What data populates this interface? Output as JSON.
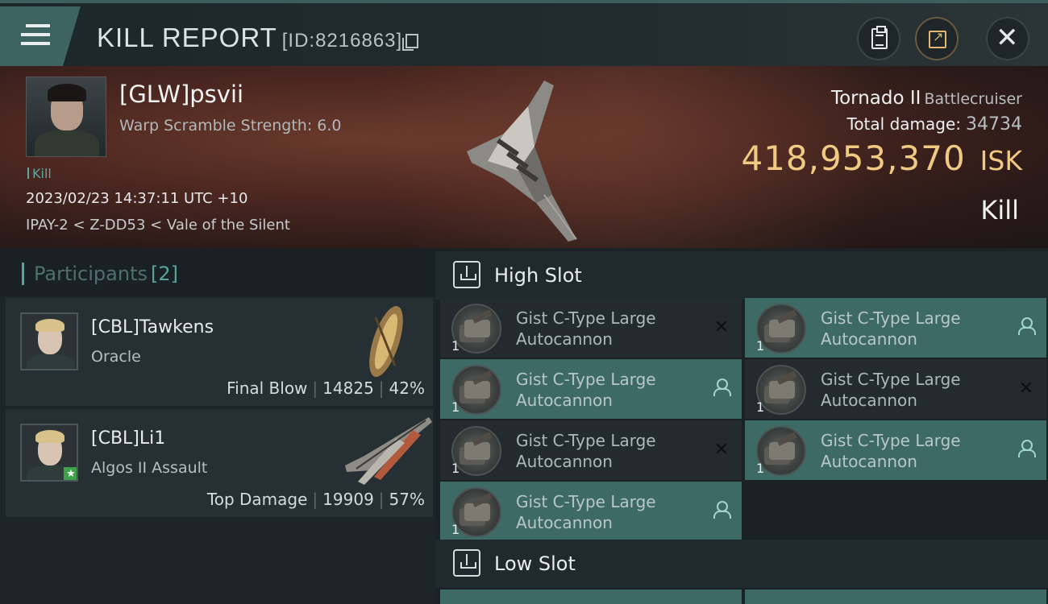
{
  "header": {
    "title": "KILL REPORT",
    "report_id": "[ID:8216863]",
    "icons": [
      "menu-icon",
      "copy-icon",
      "clipboard-icon",
      "share-icon",
      "close-icon"
    ]
  },
  "victim": {
    "name": "[GLW]psvii",
    "detail": "Warp Scramble Strength: 6.0",
    "tag": "Kill",
    "datetime": "2023/02/23 14:37:11 UTC +10",
    "location": "IPAY-2 < Z-DD53 < Vale of the Silent",
    "ship_name": "Tornado II",
    "ship_class": "Battlecruiser",
    "total_damage_label": "Total damage:",
    "total_damage": "34734",
    "isk_value": "418,953,370",
    "isk_unit": "ISK",
    "result": "Kill"
  },
  "participants": {
    "label": "Participants",
    "count": "[2]",
    "items": [
      {
        "name": "[CBL]Tawkens",
        "ship": "Oracle",
        "role": "Final Blow",
        "damage": "14825",
        "percent": "42%"
      },
      {
        "name": "[CBL]Li1",
        "ship": "Algos II Assault",
        "role": "Top Damage",
        "damage": "19909",
        "percent": "57%"
      }
    ]
  },
  "fitting": {
    "high_slot_label": "High Slot",
    "low_slot_label": "Low Slot",
    "modules": [
      {
        "qty": "1",
        "name": "Gist C-Type Large Autocannon",
        "status": "destroyed"
      },
      {
        "qty": "1",
        "name": "Gist C-Type Large Autocannon",
        "status": "dropped"
      },
      {
        "qty": "1",
        "name": "Gist C-Type Large Autocannon",
        "status": "dropped"
      },
      {
        "qty": "1",
        "name": "Gist C-Type Large Autocannon",
        "status": "destroyed"
      },
      {
        "qty": "1",
        "name": "Gist C-Type Large Autocannon",
        "status": "destroyed"
      },
      {
        "qty": "1",
        "name": "Gist C-Type Large Autocannon",
        "status": "dropped"
      },
      {
        "qty": "1",
        "name": "Gist C-Type Large Autocannon",
        "status": "dropped"
      }
    ],
    "destroyed_glyph": "✕"
  },
  "colors": {
    "accent_teal": "#5aa39d",
    "isk_gold": "#f0c983",
    "dropped_bg": "#3e6a66"
  }
}
